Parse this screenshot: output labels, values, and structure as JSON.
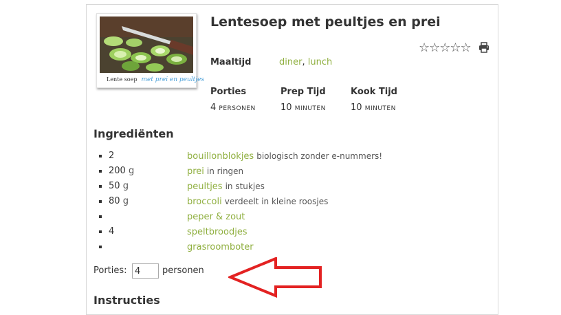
{
  "recipe": {
    "title": "Lentesoep met peultjes en prei",
    "image_caption_1": "Lente soep",
    "image_caption_2": "met prei en peultjes",
    "rating_stars": "☆☆☆☆☆",
    "print_icon": "print-icon",
    "meal_label": "Maaltijd",
    "meal_values": [
      "diner",
      "lunch"
    ],
    "meal_separator": ",",
    "stats": [
      {
        "label": "Porties",
        "value": "4",
        "unit": "personen"
      },
      {
        "label": "Prep Tijd",
        "value": "10",
        "unit": "minuten"
      },
      {
        "label": "Kook Tijd",
        "value": "10",
        "unit": "minuten"
      }
    ]
  },
  "ingredients": {
    "heading": "Ingrediënten",
    "items": [
      {
        "amount": "2",
        "unit": "",
        "name": "bouillonblokjes",
        "note": "biologisch zonder e-nummers!"
      },
      {
        "amount": "200",
        "unit": "g",
        "name": "prei",
        "note": "in ringen"
      },
      {
        "amount": "50",
        "unit": "g",
        "name": "peultjes",
        "note": "in stukjes"
      },
      {
        "amount": "80",
        "unit": "g",
        "name": "broccoli",
        "note": "verdeelt in kleine roosjes"
      },
      {
        "amount": "",
        "unit": "",
        "name": "peper & zout",
        "note": ""
      },
      {
        "amount": "4",
        "unit": "",
        "name": "speltbroodjes",
        "note": ""
      },
      {
        "amount": "",
        "unit": "",
        "name": "grasroomboter",
        "note": ""
      }
    ]
  },
  "servings": {
    "label": "Porties:",
    "value": "4",
    "unit": "personen"
  },
  "instructions": {
    "heading": "Instructies"
  },
  "colors": {
    "link": "#8faf3f",
    "annotation_arrow": "#e32222"
  }
}
